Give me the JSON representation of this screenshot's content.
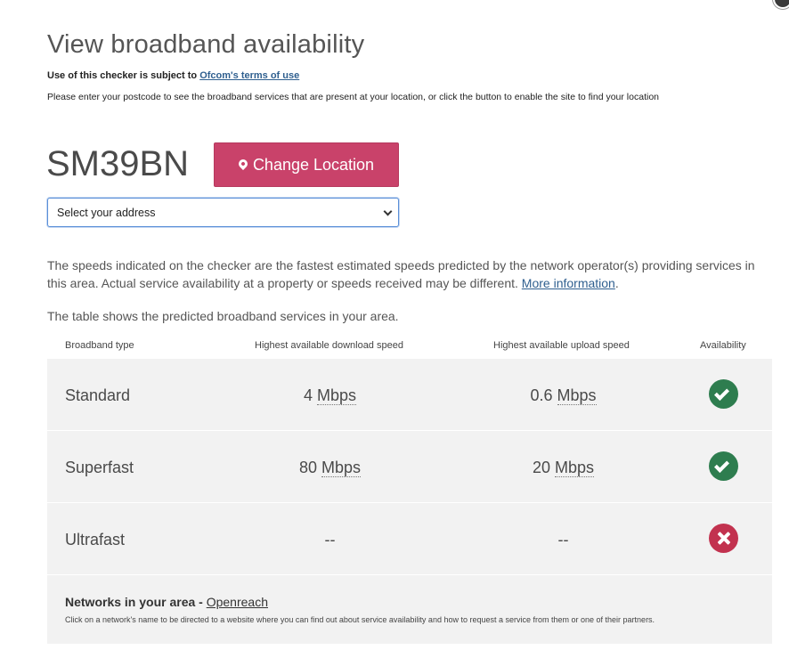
{
  "page": {
    "title": "View broadband availability",
    "terms_prefix": "Use of this checker is subject to",
    "terms_link": "Ofcom's terms of use",
    "intro": "Please enter your postcode to see the broadband services that are present at your location, or click the button to enable the site to find your location"
  },
  "location": {
    "postcode": "SM39BN",
    "change_button": "Change Location",
    "address_select": "Select your address"
  },
  "info": {
    "disclaimer": "The speeds indicated on the checker are the fastest estimated speeds predicted by the network operator(s) providing services in this area. Actual service availability at a property or speeds received may be different.",
    "more_info_link": "More information",
    "table_intro": "The table shows the predicted broadband services in your area."
  },
  "table": {
    "headers": [
      "Broadband type",
      "Highest available download speed",
      "Highest available upload speed",
      "Availability"
    ],
    "rows": [
      {
        "type": "Standard",
        "download": "4",
        "download_unit": "Mbps",
        "upload": "0.6",
        "upload_unit": "Mbps",
        "available": true,
        "icon": "check-circle-icon"
      },
      {
        "type": "Superfast",
        "download": "80",
        "download_unit": "Mbps",
        "upload": "20",
        "upload_unit": "Mbps",
        "available": true,
        "icon": "check-circle-icon"
      },
      {
        "type": "Ultrafast",
        "download": "--",
        "download_unit": "",
        "upload": "--",
        "upload_unit": "",
        "available": false,
        "icon": "cross-circle-icon"
      }
    ]
  },
  "networks": {
    "label": "Networks in your area -",
    "provider": "Openreach",
    "note": "Click on a network's name to be directed to a website where you can find out about service availability and how to request a service from them or one of their partners."
  },
  "colors": {
    "button": "#c9426a",
    "available": "#2e7d4f",
    "unavailable": "#c2324f",
    "link": "#2f5f8f"
  }
}
